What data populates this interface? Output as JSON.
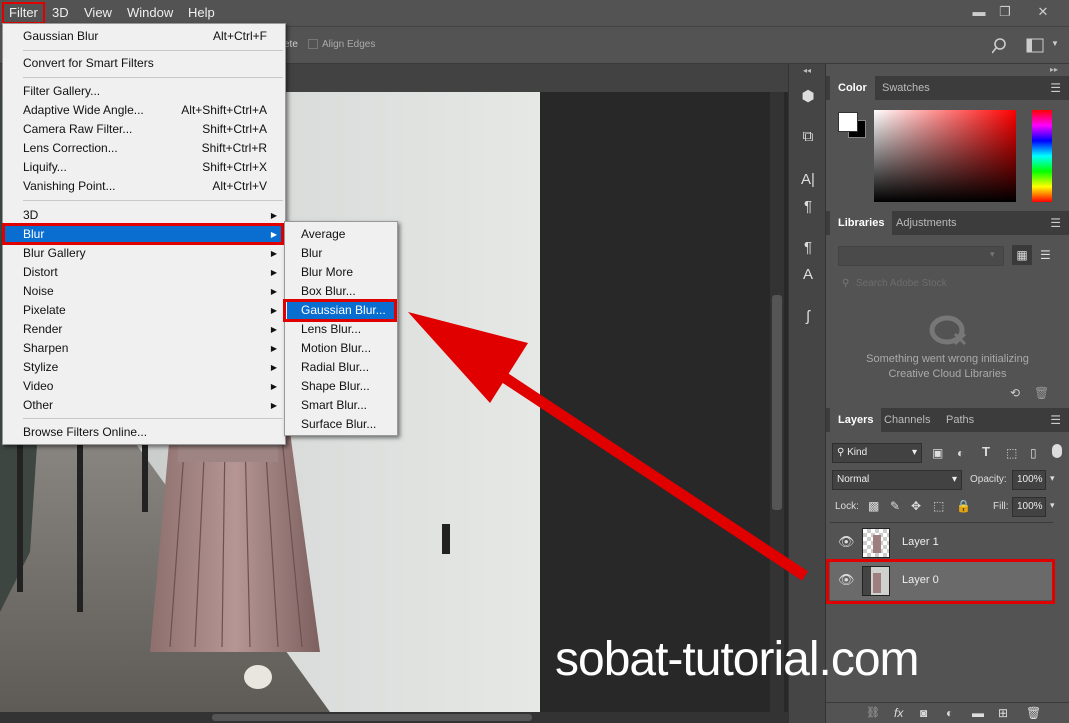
{
  "menubar": {
    "items": [
      "Filter",
      "3D",
      "View",
      "Window",
      "Help"
    ],
    "window_controls": [
      "▬",
      "❐",
      "✕"
    ]
  },
  "options_bar": {
    "partial_label": "ete",
    "align_edges_label": "Align Edges"
  },
  "filter_menu": {
    "items": [
      {
        "label": "Gaussian Blur",
        "shortcut": "Alt+Ctrl+F"
      },
      {
        "label": "Convert for Smart Filters",
        "shortcut": ""
      },
      {
        "label": "Filter Gallery...",
        "shortcut": ""
      },
      {
        "label": "Adaptive Wide Angle...",
        "shortcut": "Alt+Shift+Ctrl+A"
      },
      {
        "label": "Camera Raw Filter...",
        "shortcut": "Shift+Ctrl+A"
      },
      {
        "label": "Lens Correction...",
        "shortcut": "Shift+Ctrl+R"
      },
      {
        "label": "Liquify...",
        "shortcut": "Shift+Ctrl+X"
      },
      {
        "label": "Vanishing Point...",
        "shortcut": "Alt+Ctrl+V"
      },
      {
        "label": "3D",
        "shortcut": ""
      },
      {
        "label": "Blur",
        "shortcut": ""
      },
      {
        "label": "Blur Gallery",
        "shortcut": ""
      },
      {
        "label": "Distort",
        "shortcut": ""
      },
      {
        "label": "Noise",
        "shortcut": ""
      },
      {
        "label": "Pixelate",
        "shortcut": ""
      },
      {
        "label": "Render",
        "shortcut": ""
      },
      {
        "label": "Sharpen",
        "shortcut": ""
      },
      {
        "label": "Stylize",
        "shortcut": ""
      },
      {
        "label": "Video",
        "shortcut": ""
      },
      {
        "label": "Other",
        "shortcut": ""
      },
      {
        "label": "Browse Filters Online...",
        "shortcut": ""
      }
    ]
  },
  "blur_submenu": {
    "items": [
      "Average",
      "Blur",
      "Blur More",
      "Box Blur...",
      "Gaussian Blur...",
      "Lens Blur...",
      "Motion Blur...",
      "Radial Blur...",
      "Shape Blur...",
      "Smart Blur...",
      "Surface Blur..."
    ]
  },
  "color_panel": {
    "tabs": [
      "Color",
      "Swatches"
    ]
  },
  "libraries_panel": {
    "tabs": [
      "Libraries",
      "Adjustments"
    ],
    "search_placeholder": "Search Adobe Stock",
    "error_line1": "Something went wrong initializing",
    "error_line2": "Creative Cloud Libraries"
  },
  "layers_panel": {
    "tabs": [
      "Layers",
      "Channels",
      "Paths"
    ],
    "kind_filter": "Kind",
    "blend_mode": "Normal",
    "opacity_label": "Opacity:",
    "opacity_value": "100%",
    "lock_label": "Lock:",
    "fill_label": "Fill:",
    "fill_value": "100%",
    "layers": [
      {
        "name": "Layer 1"
      },
      {
        "name": "Layer 0"
      }
    ],
    "footer_icons": [
      "link-icon",
      "fx-icon",
      "mask-icon",
      "adjustment-icon",
      "folder-icon",
      "new-layer-icon",
      "trash-icon"
    ]
  },
  "watermark": "sobat-tutorial.com",
  "colors": {
    "highlight": "#0a6ed1",
    "annotation_red": "#e00000",
    "panel_bg": "#535353"
  }
}
